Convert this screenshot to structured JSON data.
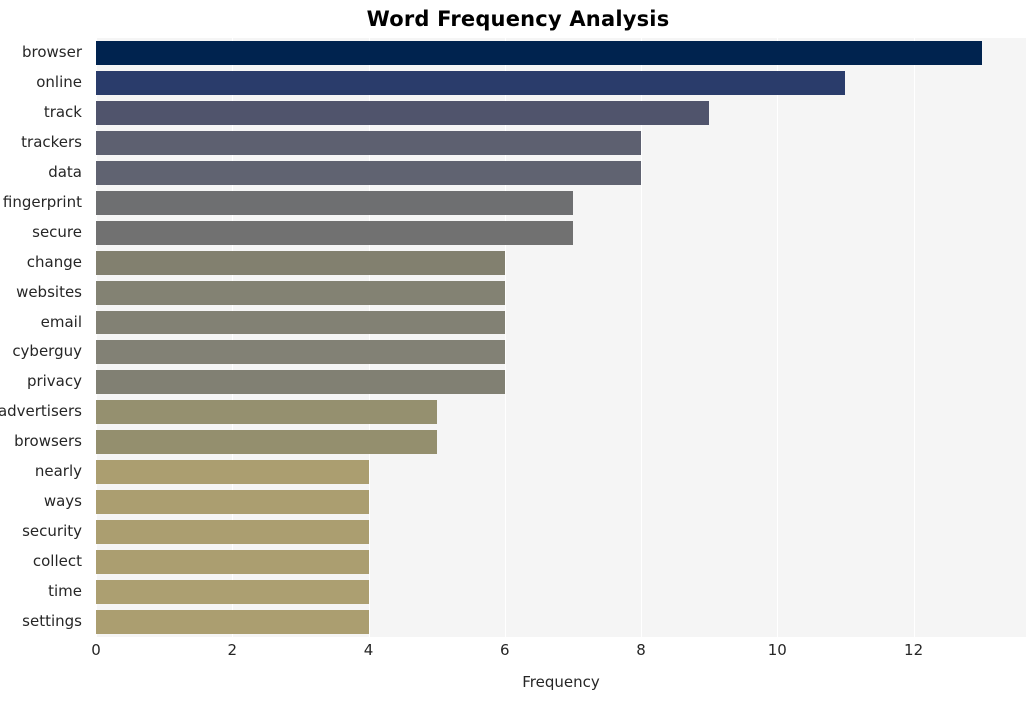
{
  "chart_data": {
    "type": "bar",
    "orientation": "horizontal",
    "title": "Word Frequency Analysis",
    "xlabel": "Frequency",
    "ylabel": "",
    "grid": true,
    "legend": null,
    "xlim": [
      0,
      13.65
    ],
    "xticks": [
      0,
      2,
      4,
      6,
      8,
      10,
      12
    ],
    "categories": [
      "browser",
      "online",
      "track",
      "trackers",
      "data",
      "fingerprint",
      "secure",
      "change",
      "websites",
      "email",
      "cyberguy",
      "privacy",
      "advertisers",
      "browsers",
      "nearly",
      "ways",
      "security",
      "collect",
      "time",
      "settings"
    ],
    "values": [
      13,
      11,
      9,
      8,
      8,
      7,
      7,
      6,
      6,
      6,
      6,
      6,
      5,
      5,
      4,
      4,
      4,
      4,
      4,
      4
    ],
    "bar_colors": [
      "#00234f",
      "#2a3c6b",
      "#50546c",
      "#5d6070",
      "#606371",
      "#6e6f71",
      "#717171",
      "#82806f",
      "#838273",
      "#828174",
      "#828175",
      "#818073",
      "#95906f",
      "#948f6e",
      "#ab9e70",
      "#ab9e70",
      "#ab9e70",
      "#ab9e70",
      "#ac9f71",
      "#ab9e70"
    ]
  },
  "style": {
    "plot_background": "#f5f5f5",
    "figure_background": "#ffffff",
    "gridline_color": "#ffffff",
    "text_color": "#262626"
  }
}
